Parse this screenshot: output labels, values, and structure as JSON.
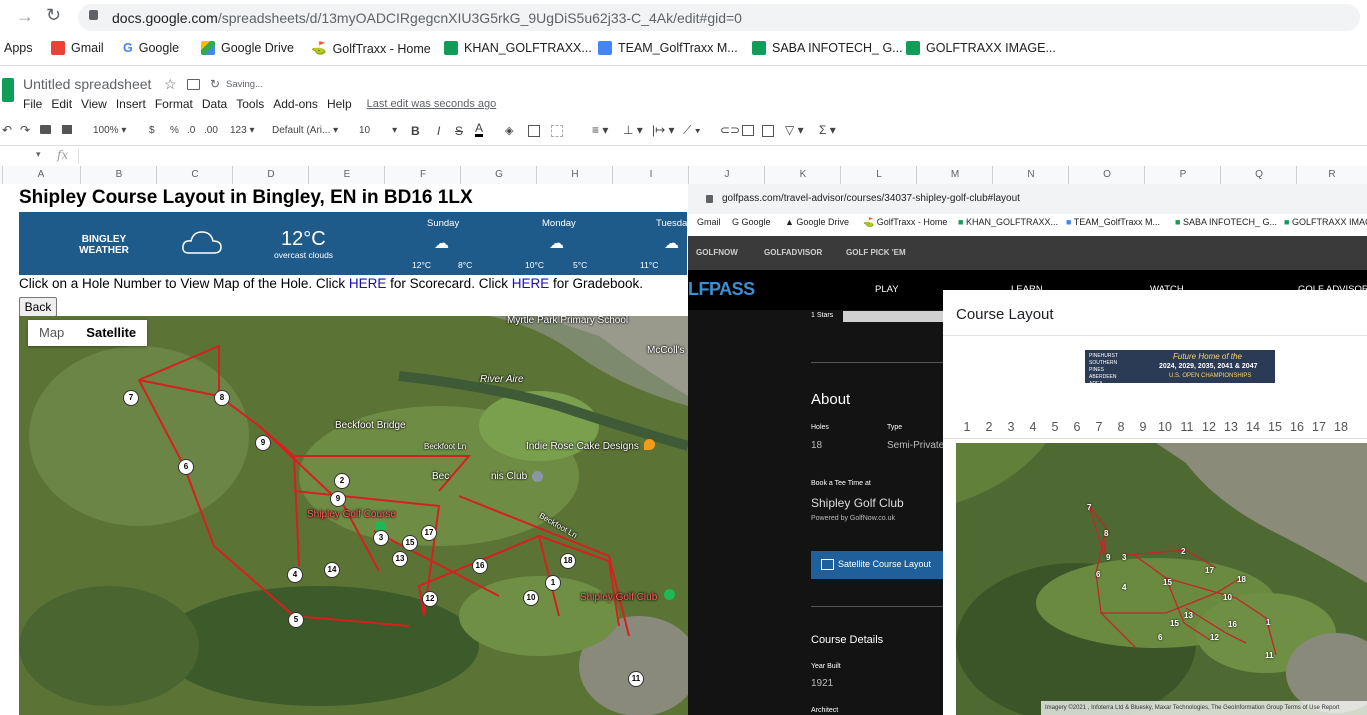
{
  "browser": {
    "url_host": "docs.google.com",
    "url_path": "/spreadsheets/d/13myOADCIRgegcnXIU3G5rkG_9UgDiS5u62j33-C_4Ak/edit#gid=0",
    "bookmarks": [
      {
        "label": "Apps",
        "icon": "apps-grid-icon",
        "color": "#5f6368"
      },
      {
        "label": "Gmail",
        "icon": "gmail-icon",
        "color": "#ea4335"
      },
      {
        "label": "Google",
        "icon": "google-icon",
        "color": "#4285f4"
      },
      {
        "label": "Google Drive",
        "icon": "drive-icon",
        "color": "#fbbc04"
      },
      {
        "label": "GolfTraxx - Home",
        "icon": "golf-icon",
        "color": "#555555"
      },
      {
        "label": "KHAN_GOLFTRAXX...",
        "icon": "sheets-icon",
        "color": "#0f9d58"
      },
      {
        "label": "TEAM_GolfTraxx M...",
        "icon": "docs-icon",
        "color": "#4285f4"
      },
      {
        "label": "SABA INFOTECH_ G...",
        "icon": "sheets-icon",
        "color": "#0f9d58"
      },
      {
        "label": "GOLFTRAXX IMAGE...",
        "icon": "sheets-icon",
        "color": "#0f9d58"
      }
    ]
  },
  "sheets": {
    "doc_title": "Untitled spreadsheet",
    "saving_status": "Saving...",
    "menu": [
      "File",
      "Edit",
      "View",
      "Insert",
      "Format",
      "Data",
      "Tools",
      "Add-ons",
      "Help"
    ],
    "last_edit": "Last edit was seconds ago",
    "toolbar": {
      "zoom": "100%",
      "currency": "$",
      "percent": "%",
      "decimal_dec": ".0",
      "decimal_inc": ".00",
      "more_formats": "123",
      "font": "Default (Ari...",
      "font_size": "10",
      "bold": "B",
      "italic": "I",
      "strike": "S",
      "text_color": "A",
      "sum": "Σ"
    },
    "formula_icon": "fx",
    "columns": [
      "A",
      "B",
      "C",
      "D",
      "E",
      "F",
      "G",
      "H",
      "I",
      "J",
      "K",
      "L",
      "M",
      "N",
      "O",
      "P",
      "Q",
      "R"
    ]
  },
  "course_page": {
    "title": "Shipley Course Layout in Bingley, EN in BD16 1LX",
    "weather": {
      "location": "BINGLEY WEATHER",
      "temp": "12°C",
      "desc": "overcast clouds",
      "days": [
        {
          "day": "Sunday",
          "hi": "12°C",
          "lo": "8°C"
        },
        {
          "day": "Monday",
          "hi": "10°C",
          "lo": "5°C"
        },
        {
          "day": "Tuesda",
          "hi": "11°C",
          "lo": ""
        }
      ]
    },
    "instructions_a": "Click on a Hole Number to View Map of the Hole. Click ",
    "link1": "HERE",
    "instructions_b": " for Scorecard. Click ",
    "link2": "HERE",
    "instructions_c": " for Gradebook.",
    "back_label": "Back",
    "map": {
      "map_btn": "Map",
      "satellite_btn": "Satellite",
      "labels": [
        "Myrtle Park Primary School",
        "McColl's",
        "River Aire",
        "Beckfoot Bridge",
        "Indie Rose Cake Designs",
        "Beckfoot Ln",
        "Bec",
        "nis Club",
        "Shipley Golf Course",
        "Shipley Golf Club",
        "Beckfoot Ln"
      ],
      "holes": [
        "7",
        "8",
        "9",
        "6",
        "2",
        "9",
        "3",
        "15",
        "17",
        "13",
        "14",
        "16",
        "18",
        "4",
        "1",
        "12",
        "10",
        "5",
        "11"
      ]
    }
  },
  "golfpass": {
    "url": "golfpass.com/travel-advisor/courses/34037-shipley-golf-club#layout",
    "bookmarks": [
      "Gmail",
      "Google",
      "Google Drive",
      "GolfTraxx - Home",
      "KHAN_GOLFTRAXX...",
      "TEAM_GolfTraxx M...",
      "SABA INFOTECH_ G...",
      "GOLFTRAXX IMAGE"
    ],
    "topnav": [
      "GOLFNOW",
      "GOLFADVISOR",
      "GOLF PICK 'EM"
    ],
    "brand": "LFPASS",
    "mainnav": [
      "PLAY",
      "LEARN",
      "WATCH",
      "GOLF ADVISOR"
    ],
    "stars_label": "1 Stars",
    "about": "About",
    "holes_label": "Holes",
    "holes_value": "18",
    "type_label": "Type",
    "type_value": "Semi-Private",
    "tee_label": "Book a Tee Time at",
    "tee_club": "Shipley Golf Club",
    "powered": "Powered by GolfNow.co.uk",
    "sat_btn": "Satellite Course Layout",
    "details": "Course Details",
    "year_label": "Year Built",
    "year_value": "1921",
    "architect_label": "Architect"
  },
  "modal": {
    "title": "Course Layout",
    "banner_a": "PINEHURST SOUTHERN PINES ABERDEEN AREA",
    "banner_b": "Future Home of the",
    "banner_c": "2024, 2029, 2035, 2041 & 2047",
    "banner_d": "U.S. OPEN CHAMPIONSHIPS",
    "hole_tabs": [
      "1",
      "2",
      "3",
      "4",
      "5",
      "6",
      "7",
      "8",
      "9",
      "10",
      "11",
      "12",
      "13",
      "14",
      "15",
      "16",
      "17",
      "18"
    ],
    "attribution": "Imagery ©2021 , Infoterra Ltd & Bluesky, Maxar Technologies, The GeoInformation Group",
    "terms": "Terms of Use",
    "report": "Report",
    "holes": [
      "7",
      "8",
      "9",
      "3",
      "2",
      "6",
      "4",
      "15",
      "17",
      "18",
      "10",
      "13",
      "16",
      "1",
      "15",
      "12",
      "6",
      "11"
    ]
  }
}
